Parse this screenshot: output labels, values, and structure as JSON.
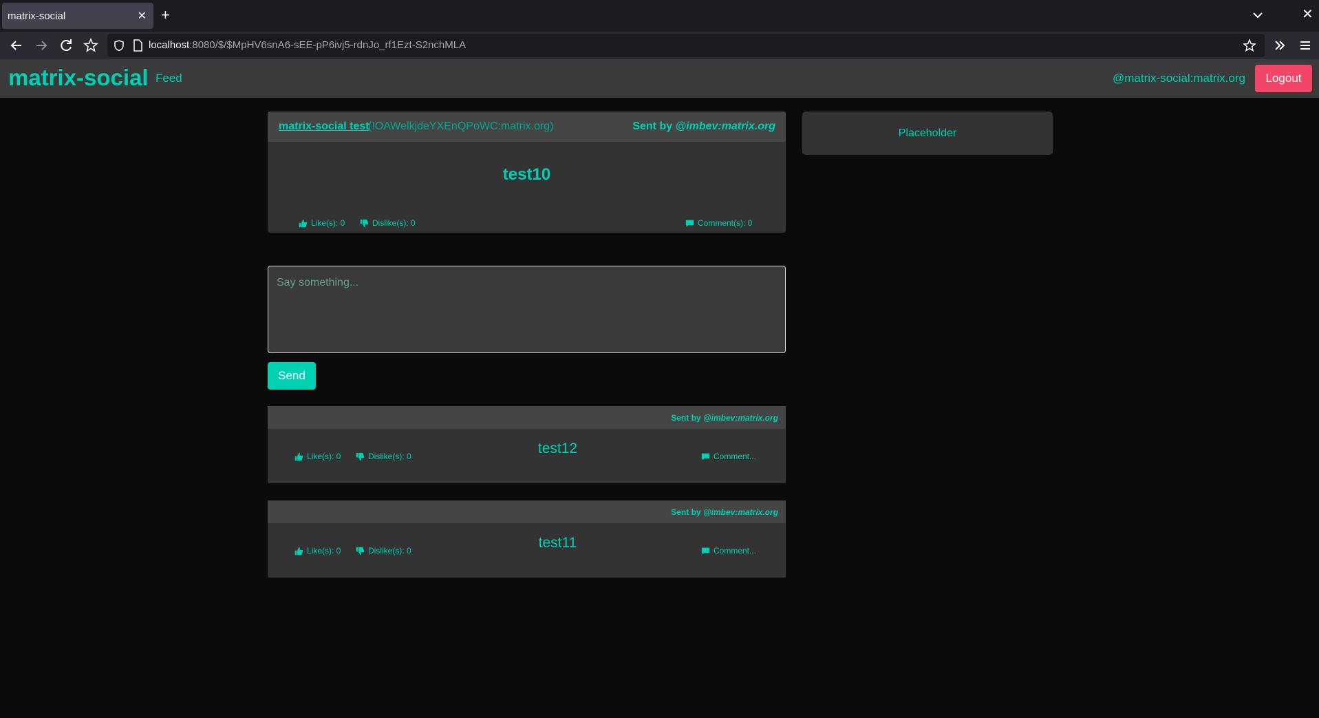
{
  "browser": {
    "tab_title": "matrix-social",
    "url_host": "localhost",
    "url_rest": ":8080/$/$MpHV6snA6-sEE-pP6ivj5-rdnJo_rf1Ezt-S2nchMLA"
  },
  "header": {
    "brand": "matrix-social",
    "nav_feed": "Feed",
    "user_id": "@matrix-social:matrix.org",
    "logout_label": "Logout"
  },
  "post": {
    "room_name": "matrix-social test",
    "room_id": "(!OAWelkjdeYXEnQPoWC:matrix.org)",
    "sent_by_prefix": "Sent by",
    "sent_by_user": "@imbev:matrix.org",
    "title": "test10",
    "likes_label": "Like(s): 0",
    "dislikes_label": "Dislike(s): 0",
    "comments_label": "Comment(s): 0"
  },
  "composer": {
    "placeholder": "Say something...",
    "send_label": "Send"
  },
  "comments": [
    {
      "sent_by_prefix": "Sent by",
      "sent_by_user": "@imbev:matrix.org",
      "text": "test12",
      "likes_label": "Like(s): 0",
      "dislikes_label": "Dislike(s): 0",
      "comment_label": "Comment..."
    },
    {
      "sent_by_prefix": "Sent by",
      "sent_by_user": "@imbev:matrix.org",
      "text": "test11",
      "likes_label": "Like(s): 0",
      "dislikes_label": "Dislike(s): 0",
      "comment_label": "Comment..."
    }
  ],
  "sidebar": {
    "label": "Placeholder"
  },
  "colors": {
    "accent": "#00d1b2",
    "danger": "#f14668",
    "background": "#0b0b0b",
    "card": "#333333"
  }
}
